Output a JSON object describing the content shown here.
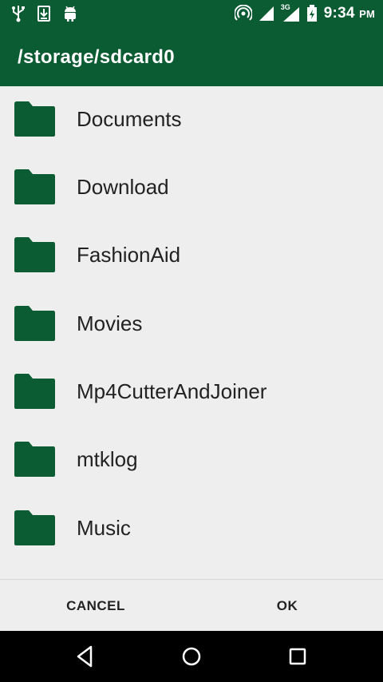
{
  "status_bar": {
    "time": "9:34",
    "ampm": "PM",
    "network_label": "3G",
    "icons": [
      "usb-icon",
      "download-icon",
      "android-icon",
      "hotspot-icon",
      "signal-icon",
      "signal-3g-icon",
      "battery-icon"
    ]
  },
  "app_bar": {
    "title": "/storage/sdcard0"
  },
  "folders": [
    {
      "name": "Documents"
    },
    {
      "name": "Download"
    },
    {
      "name": "FashionAid"
    },
    {
      "name": "Movies"
    },
    {
      "name": "Mp4CutterAndJoiner"
    },
    {
      "name": "mtklog"
    },
    {
      "name": "Music"
    }
  ],
  "actions": {
    "cancel_label": "CANCEL",
    "ok_label": "OK"
  },
  "nav_bar": {
    "icons": [
      "back-icon",
      "home-icon",
      "recents-icon"
    ]
  },
  "colors": {
    "accent": "#0b5b33",
    "background": "#eeeeee",
    "folder": "#0b5b33"
  }
}
